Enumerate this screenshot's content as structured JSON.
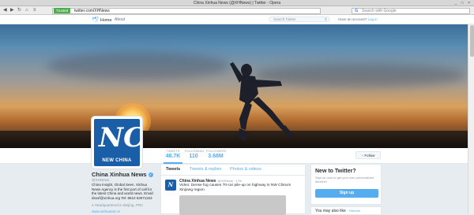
{
  "window": {
    "title": "China Xinhua News (@XHNews) | Twitter - Opera",
    "controls": "_ □ ×"
  },
  "browser": {
    "back_icon": "◀",
    "forward_icon": "▶",
    "reload_icon": "↻",
    "home_icon": "⌂",
    "menu_icon": "≡",
    "trusted_label": "Trusted",
    "url": "twitter.com/XHNews",
    "search_placeholder": "Search with Google",
    "search_engine_icon": "G"
  },
  "twitter_nav": {
    "home_label": "Home",
    "about_label": "About",
    "search_placeholder": "Search Twitter",
    "login_prompt": "Have an account?",
    "login_link": "Log in"
  },
  "profile_nav": {
    "stats": [
      {
        "label": "TWEETS",
        "value": "48.7K"
      },
      {
        "label": "FOLLOWING",
        "value": "110"
      },
      {
        "label": "FOLLOWERS",
        "value": "3.68M"
      }
    ],
    "follow_label": "Follow"
  },
  "profile": {
    "avatar_mark": "NC",
    "avatar_text": "NEW CHINA",
    "name": "China Xinhua News",
    "handle": "@XHNews",
    "bio": "China Insight, Global Seen. Xinhua News Agency is the first port of call for the latest China and world news. Email: dsxxf@xinhua.org Tel: 8610 63071153",
    "location": "Headquartered in Beijing, PRC",
    "website": "www.xinhuanet.cn"
  },
  "timeline": {
    "tabs": [
      "Tweets",
      "Tweets & replies",
      "Photos & videos"
    ],
    "tweet": {
      "author": "China Xinhua News",
      "meta": "@XHNews · 17m",
      "text": "Video: Dense fog causes 70-car pile-up on highway in NW China's Xinjiang region"
    }
  },
  "sidebar": {
    "new_title": "New to Twitter?",
    "new_subtitle": "Sign up now to get your own personalized timeline!",
    "signup_label": "Sign up",
    "may_like_title": "You may also like",
    "refresh_label": "· Refresh"
  },
  "colors": {
    "accent": "#55acee",
    "brand_blue": "#1a5ea8"
  }
}
